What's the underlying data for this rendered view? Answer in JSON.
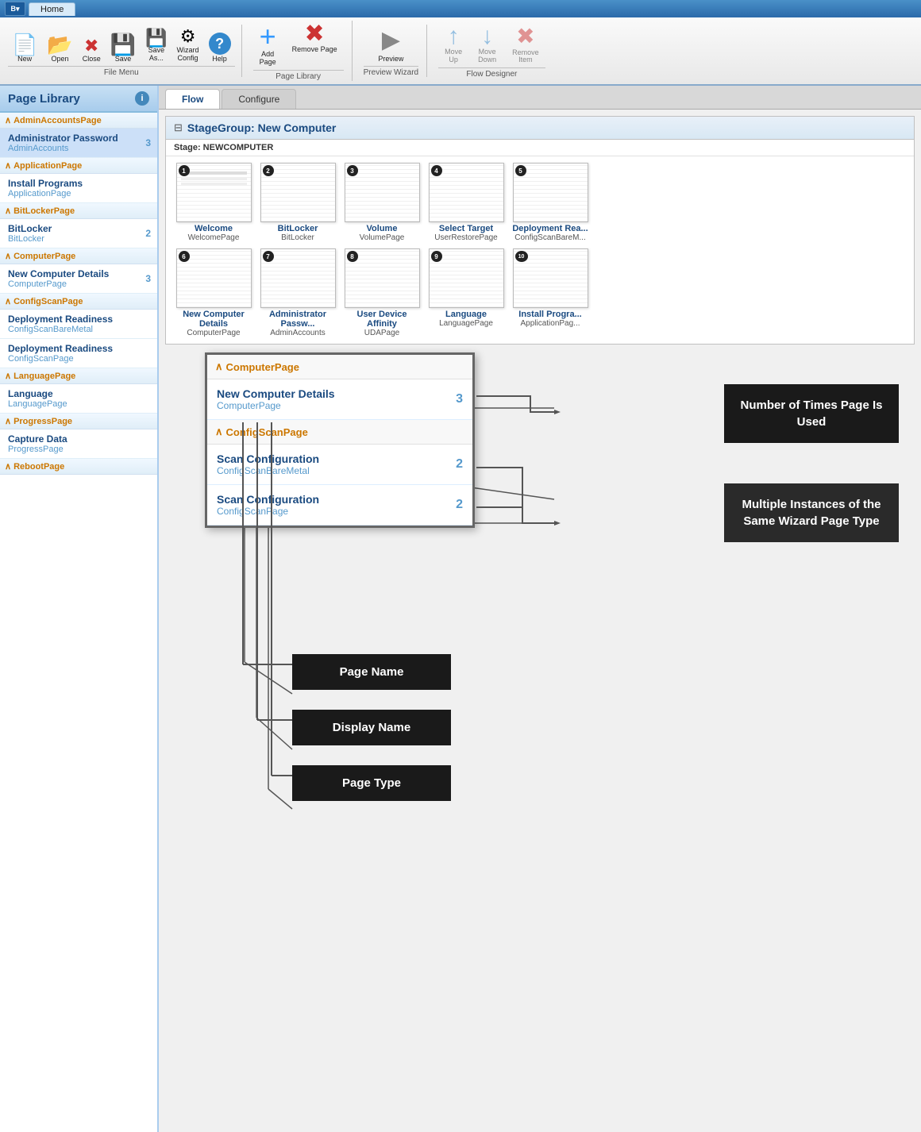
{
  "titlebar": {
    "logo_label": "B",
    "tab_label": "Home"
  },
  "ribbon": {
    "groups": [
      {
        "label": "File Menu",
        "buttons": [
          {
            "id": "new",
            "label": "New",
            "icon": "📄"
          },
          {
            "id": "open",
            "label": "Open",
            "icon": "📂"
          },
          {
            "id": "close",
            "label": "Close",
            "icon": "✖"
          },
          {
            "id": "save",
            "label": "Save",
            "icon": "💾"
          },
          {
            "id": "save-as",
            "label": "Save As...",
            "icon": "💾"
          },
          {
            "id": "wizard-config",
            "label": "Wizard\nConfig",
            "icon": "⚙"
          },
          {
            "id": "help",
            "label": "Help",
            "icon": "❓"
          }
        ]
      },
      {
        "label": "Page Library",
        "buttons": [
          {
            "id": "add-page",
            "label": "Add\nPage",
            "icon": "+"
          },
          {
            "id": "remove-page",
            "label": "Remove\nPage",
            "icon": "✖"
          }
        ]
      },
      {
        "label": "Preview Wizard",
        "buttons": [
          {
            "id": "preview",
            "label": "Preview",
            "icon": "▶"
          }
        ]
      },
      {
        "label": "Flow Designer",
        "buttons": [
          {
            "id": "move-up",
            "label": "Move\nUp",
            "icon": "↑"
          },
          {
            "id": "move-down",
            "label": "Move\nDown",
            "icon": "↓"
          },
          {
            "id": "remove-item",
            "label": "Remove\nItem",
            "icon": "✖"
          }
        ]
      }
    ]
  },
  "sidebar": {
    "title": "Page Library",
    "groups": [
      {
        "name": "AdminAccountsPage",
        "items": [
          {
            "display_name": "Administrator Password",
            "type": "AdminAccounts",
            "count": 3
          }
        ]
      },
      {
        "name": "ApplicationPage",
        "items": [
          {
            "display_name": "Install Programs",
            "type": "ApplicationPage",
            "count": null
          }
        ]
      },
      {
        "name": "BitLockerPage",
        "items": [
          {
            "display_name": "BitLocker",
            "type": "BitLocker",
            "count": 2
          }
        ]
      },
      {
        "name": "ComputerPage",
        "items": [
          {
            "display_name": "New Computer Details",
            "type": "ComputerPage",
            "count": 3
          }
        ]
      },
      {
        "name": "ConfigScanPage",
        "items": [
          {
            "display_name": "Deployment Readiness",
            "type": "ConfigScanBareMetal",
            "count": null
          },
          {
            "display_name": "Deployment Readiness",
            "type": "ConfigScanPage",
            "count": null
          }
        ]
      },
      {
        "name": "LanguagePage",
        "items": [
          {
            "display_name": "Language",
            "type": "LanguagePage",
            "count": null
          }
        ]
      },
      {
        "name": "ProgressPage",
        "items": [
          {
            "display_name": "Capture Data",
            "type": "ProgressPage",
            "count": null
          }
        ]
      },
      {
        "name": "RebootPage",
        "items": []
      }
    ]
  },
  "tabs": [
    {
      "label": "Flow",
      "active": true
    },
    {
      "label": "Configure",
      "active": false
    }
  ],
  "flow": {
    "stage_group_title": "StageGroup: New Computer",
    "stage_label": "Stage: NEWCOMPUTER",
    "pages_row1": [
      {
        "num": 1,
        "name": "Welcome",
        "type": "WelcomePage"
      },
      {
        "num": 2,
        "name": "BitLocker",
        "type": "BitLocker"
      },
      {
        "num": 3,
        "name": "Volume",
        "type": "VolumePage"
      },
      {
        "num": 4,
        "name": "Select Target",
        "type": "UserRestorePage"
      },
      {
        "num": 5,
        "name": "Deployment Rea...",
        "type": "ConfigScanBareM..."
      }
    ],
    "pages_row2": [
      {
        "num": 6,
        "name": "New Computer Details",
        "type": "ComputerPage"
      },
      {
        "num": 7,
        "name": "Administrator Passw...",
        "type": "AdminAccounts"
      },
      {
        "num": 8,
        "name": "User Device Affinity",
        "type": "UDAPage"
      },
      {
        "num": 9,
        "name": "Language",
        "type": "LanguagePage"
      },
      {
        "num": 10,
        "name": "Install Progra...",
        "type": "ApplicationPag..."
      }
    ]
  },
  "zoomed_panel": {
    "groups": [
      {
        "name": "ComputerPage",
        "items": [
          {
            "display_name": "New Computer Details",
            "type": "ComputerPage",
            "count": 3
          }
        ]
      },
      {
        "name": "ConfigScanPage",
        "items": [
          {
            "display_name": "Scan Configuration",
            "type": "ConfigScanBareMetal",
            "count": 2
          },
          {
            "display_name": "Scan Configuration",
            "type": "ConfigScanPage",
            "count": 2
          }
        ]
      }
    ]
  },
  "annotations": {
    "number_of_times": "Number of Times\nPage Is Used",
    "multiple_instances": "Multiple Instances\nof the Same\nWizard Page Type",
    "page_name": "Page Name",
    "display_name": "Display Name",
    "page_type": "Page Type"
  },
  "colors": {
    "header_blue": "#1a4a80",
    "accent_orange": "#cc7700",
    "link_blue": "#5599cc",
    "dark_bg": "#1a1a1a"
  }
}
